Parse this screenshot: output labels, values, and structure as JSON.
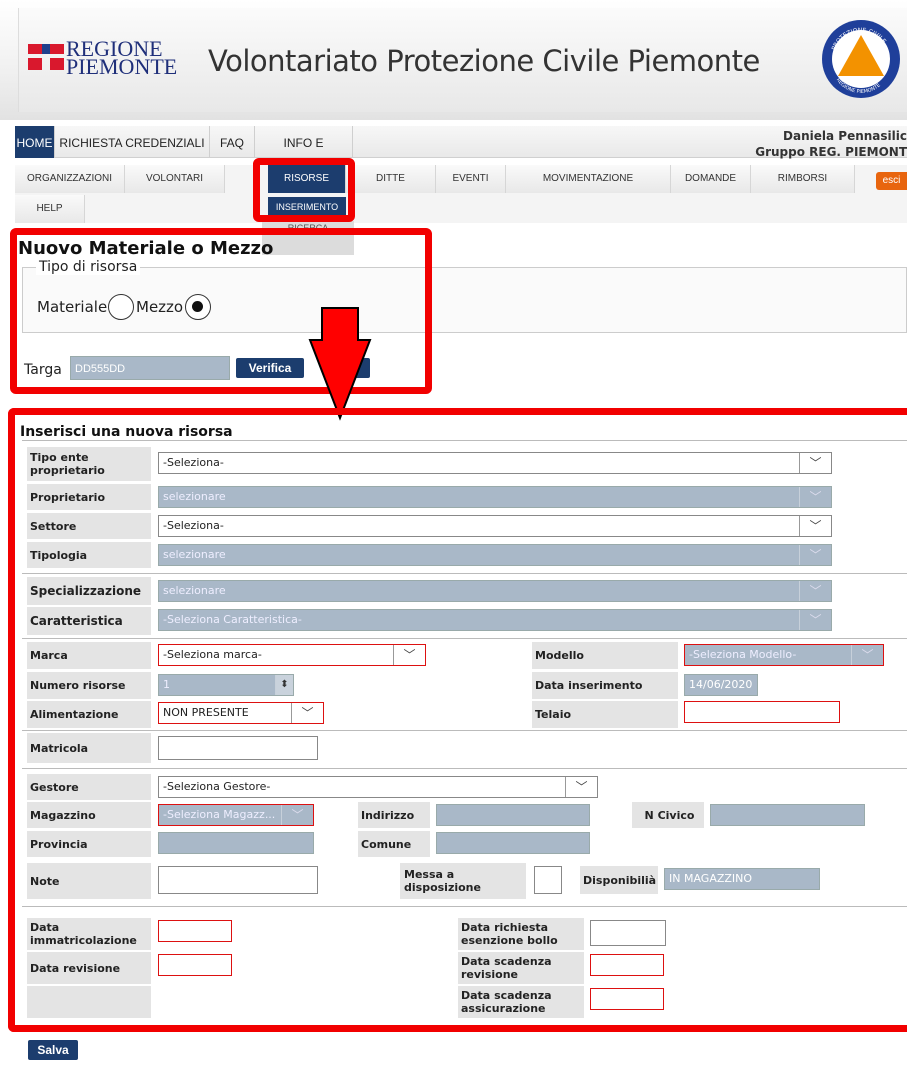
{
  "header": {
    "logo_line1": "REGIONE",
    "logo_line2": "PIEMONTE",
    "title": "Volontariato Protezione Civile Piemonte",
    "badge_top": "PROTEZIONE CIVILE",
    "badge_bottom": "REGIONE PIEMONTE"
  },
  "nav1": {
    "items": [
      "HOME",
      "RICHIESTA CREDENZIALI",
      "FAQ",
      "INFO E CONTATTI"
    ],
    "user_name": "Daniela Pennasilic",
    "user_group": "Gruppo REG. PIEMONT"
  },
  "nav2": {
    "items": [
      "ORGANIZZAZIONI",
      "VOLONTARI",
      "RISORSE",
      "DITTE",
      "EVENTI",
      "MOVIMENTAZIONE",
      "DOMANDE",
      "RIMBORSI"
    ],
    "help": "HELP",
    "esci": "esci",
    "sub_inserimento": "INSERIMENTO",
    "sub_ricerca": "RICERCA"
  },
  "section1": {
    "title": "Nuovo Materiale o Mezzo",
    "legend": "Tipo di risorsa",
    "materiale": "Materiale",
    "mezzo": "Mezzo",
    "selected": "Mezzo",
    "targa_label": "Targa",
    "targa_value": "DD555DD",
    "verifica": "Verifica"
  },
  "section2": {
    "title": "Inserisci una nuova risorsa",
    "tipo_ente_label": "Tipo ente proprietario",
    "tipo_ente_value": "-Seleziona-",
    "proprietario_label": "Proprietario",
    "proprietario_value": "selezionare",
    "settore_label": "Settore",
    "settore_value": "-Seleziona-",
    "tipologia_label": "Tipologia",
    "tipologia_value": "selezionare",
    "specializzazione_label": "Specializzazione",
    "specializzazione_value": "selezionare",
    "caratteristica_label": "Caratteristica",
    "caratteristica_value": "-Seleziona Caratteristica-",
    "marca_label": "Marca",
    "marca_value": "-Seleziona marca-",
    "modello_label": "Modello",
    "modello_value": "-Seleziona Modello-",
    "numero_label": "Numero risorse",
    "numero_value": "1",
    "data_ins_label": "Data inserimento",
    "data_ins_value": "14/06/2020",
    "alimentazione_label": "Alimentazione",
    "alimentazione_value": "NON PRESENTE",
    "telaio_label": "Telaio",
    "matricola_label": "Matricola",
    "gestore_label": "Gestore",
    "gestore_value": "-Seleziona Gestore-",
    "magazzino_label": "Magazzino",
    "magazzino_value": "-Seleziona Magazz...",
    "indirizzo_label": "Indirizzo",
    "ncivico_label": "N Civico",
    "provincia_label": "Provincia",
    "comune_label": "Comune",
    "note_label": "Note",
    "messa_label": "Messa a disposizione",
    "disponibilita_label": "Disponibilià",
    "disponibilita_value": "IN MAGAZZINO",
    "data_immatricolazione_label": "Data immatricolazione",
    "data_esenzione_label": "Data richiesta esenzione bollo",
    "data_revisione_label": "Data revisione",
    "data_scad_revisione_label": "Data scadenza revisione",
    "data_scad_assicurazione_label": "Data scadenza assicurazione"
  },
  "salva": "Salva",
  "colors": {
    "nav_active": "#1c3d6e",
    "highlight": "#f20000",
    "esci": "#e8650e"
  }
}
